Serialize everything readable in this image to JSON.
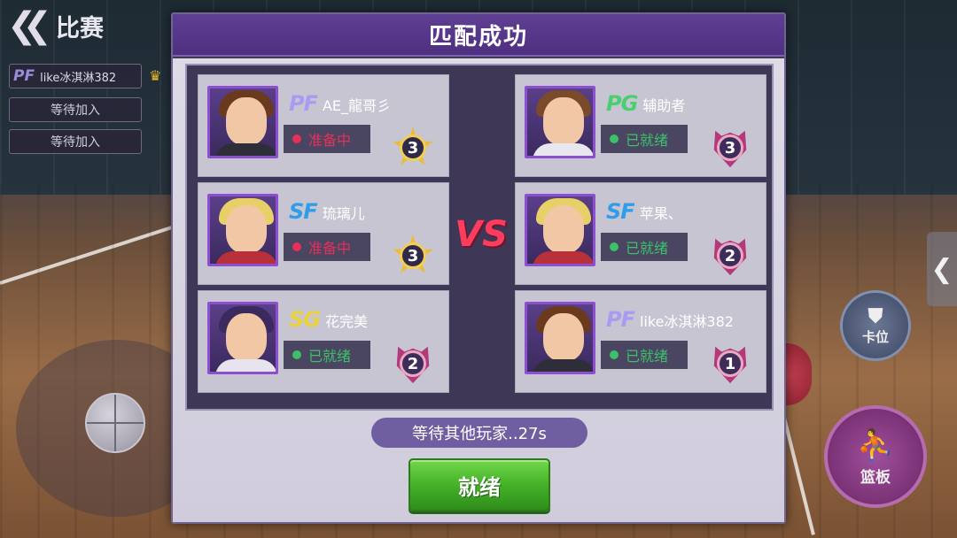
{
  "hud": {
    "back_label": "比赛",
    "player_position": "PF",
    "player_name": "like冰淇淋382",
    "wait_slots": [
      "等待加入",
      "等待加入"
    ]
  },
  "side_controls": {
    "kawei_label": "卡位",
    "lanban_label": "篮板"
  },
  "modal": {
    "title": "匹配成功",
    "vs_label": "VS",
    "wait_text": "等待其他玩家..27s",
    "ready_label": "就绪"
  },
  "team_left": [
    {
      "position": "PF",
      "name": "AE_龍哥彡",
      "status": "准备中",
      "level": "3"
    },
    {
      "position": "SF",
      "name": "琉璃儿",
      "status": "准备中",
      "level": "3"
    },
    {
      "position": "SG",
      "name": "花完美",
      "status": "已就绪",
      "level": "2"
    }
  ],
  "team_right": [
    {
      "position": "PG",
      "name": "辅助者",
      "status": "已就绪",
      "level": "3"
    },
    {
      "position": "SF",
      "name": "苹果、",
      "status": "已就绪",
      "level": "2"
    },
    {
      "position": "PF",
      "name": "like冰淇淋382",
      "status": "已就绪",
      "level": "1"
    }
  ],
  "colors": {
    "modal_header": "#5f3f93",
    "status_preparing": "#e6305a",
    "status_ready": "#3cc06a",
    "pos_PF": "#a79cf0",
    "pos_SF": "#2f9de8",
    "pos_SG": "#ecd23a",
    "pos_PG": "#48d070",
    "vs": "#ff3c5e",
    "ready_button": "#44b228"
  }
}
